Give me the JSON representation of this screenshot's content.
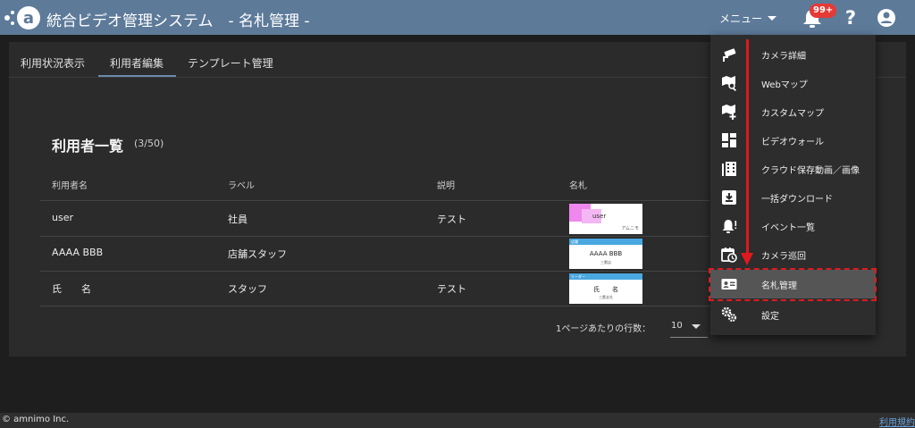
{
  "header": {
    "title": "統合ビデオ管理システム　- 名札管理 -",
    "menu_label": "メニュー",
    "notification_badge": "99+",
    "help_label": "?"
  },
  "tabs": [
    {
      "label": "利用状況表示"
    },
    {
      "label": "利用者編集"
    },
    {
      "label": "テンプレート管理"
    }
  ],
  "active_tab": "利用者編集",
  "list": {
    "title": "利用者一覧",
    "count": "(3/50)",
    "columns": [
      "利用者名",
      "ラベル",
      "説明",
      "名札"
    ],
    "rows": [
      {
        "name": "user",
        "label": "社員",
        "description": "テスト",
        "card": {
          "name": "user",
          "sub": "アムニモ"
        }
      },
      {
        "name": "AAAA BBB",
        "label": "店舗スタッフ",
        "description": "",
        "card": {
          "band": "店舗",
          "name": "AAAA BBB",
          "sub": "三鷹店"
        }
      },
      {
        "name": "氏　　名",
        "label": "スタッフ",
        "description": "テスト",
        "card": {
          "band": "リーダー",
          "name": "氏　　名",
          "sub": "三鷹支社"
        }
      }
    ],
    "rows_per_page_label": "1ページあたりの行数：",
    "rows_per_page_value": "10"
  },
  "dropdown": {
    "items": [
      {
        "label": "カメラ詳細",
        "icon": "cctv-icon"
      },
      {
        "label": "Webマップ",
        "icon": "map-search-icon"
      },
      {
        "label": "カスタムマップ",
        "icon": "map-plus-icon"
      },
      {
        "label": "ビデオウォール",
        "icon": "dashboard-icon"
      },
      {
        "label": "クラウド保存動画／画像",
        "icon": "video-library-icon"
      },
      {
        "label": "一括ダウンロード",
        "icon": "download-box-icon"
      },
      {
        "label": "イベント一覧",
        "icon": "bell-alert-icon"
      },
      {
        "label": "カメラ巡回",
        "icon": "calendar-clock-icon"
      },
      {
        "label": "名札管理",
        "icon": "id-card-icon"
      },
      {
        "label": "設定",
        "icon": "cogs-icon"
      }
    ],
    "highlighted": "名札管理"
  },
  "footer": {
    "copyright": "© amnimo Inc.",
    "terms": "利用規約"
  },
  "colors": {
    "header": "#5d7a99",
    "highlight": "#e0191e",
    "badge": "#e53935"
  }
}
